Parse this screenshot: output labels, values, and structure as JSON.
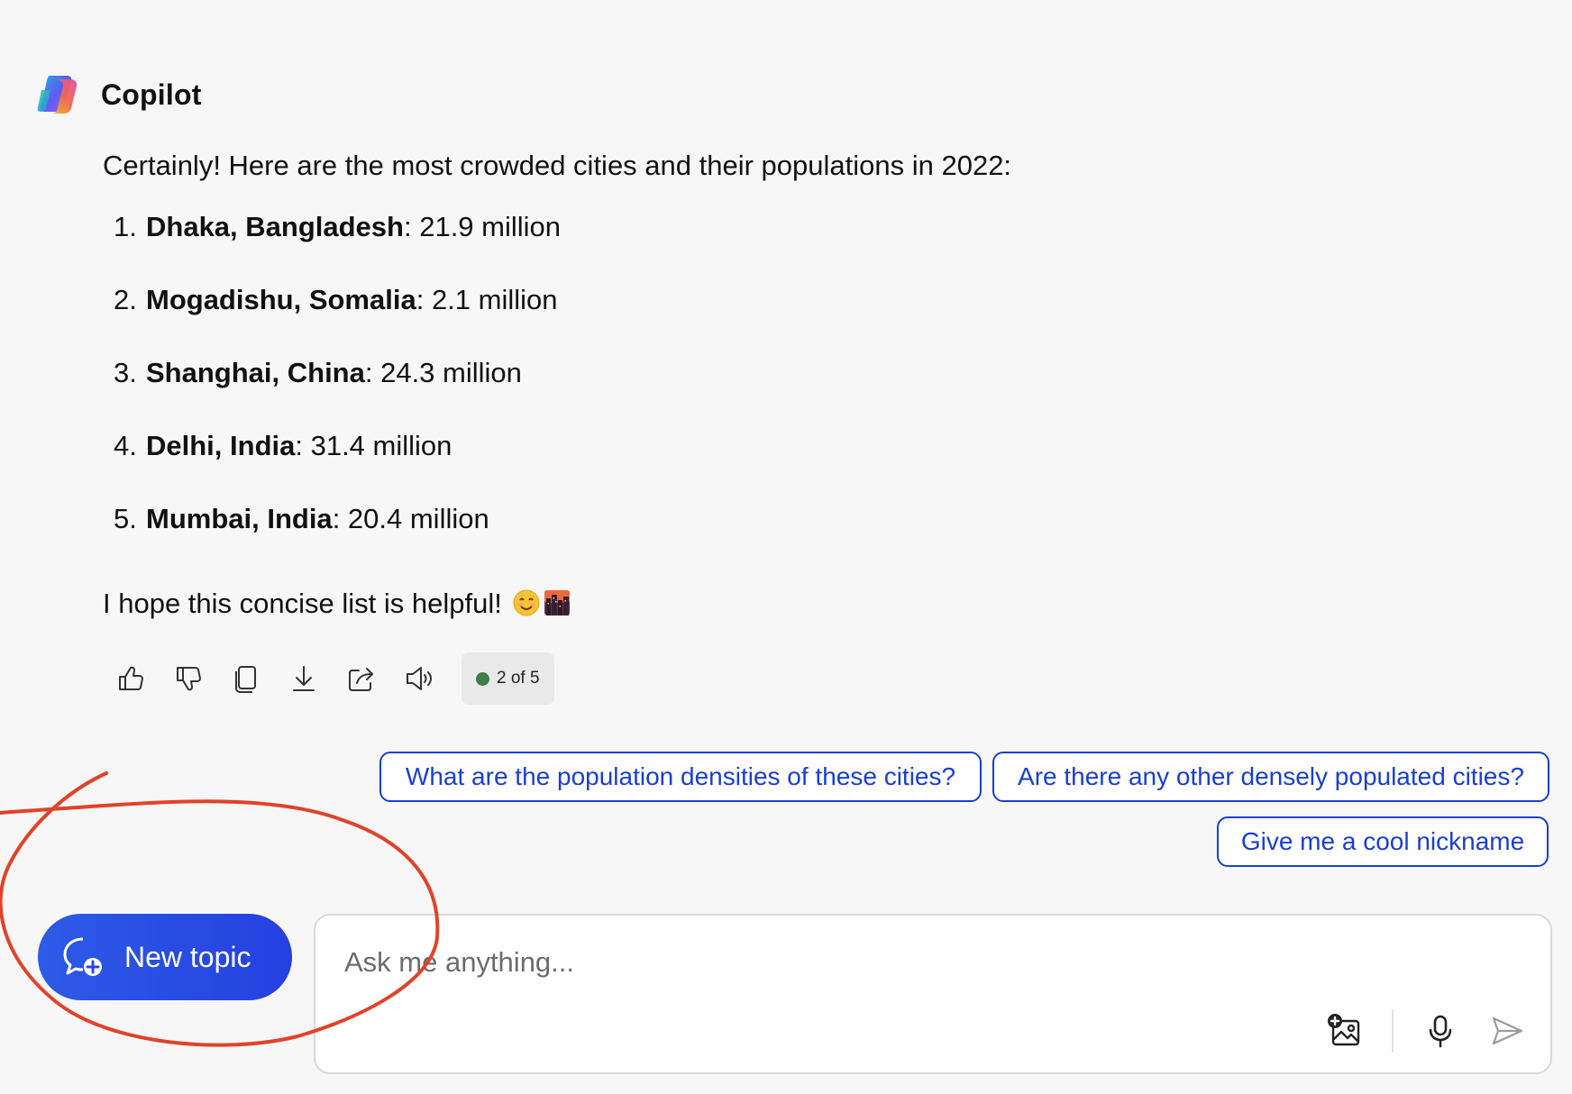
{
  "app": {
    "title": "Copilot"
  },
  "message": {
    "intro": "Certainly! Here are the most crowded cities and their populations in 2022:",
    "items": [
      {
        "num": "1.",
        "name": "Dhaka, Bangladesh",
        "value": ": 21.9 million"
      },
      {
        "num": "2.",
        "name": "Mogadishu, Somalia",
        "value": ": 2.1 million"
      },
      {
        "num": "3.",
        "name": "Shanghai, China",
        "value": ": 24.3 million"
      },
      {
        "num": "4.",
        "name": "Delhi, India",
        "value": ": 31.4 million"
      },
      {
        "num": "5.",
        "name": "Mumbai, India",
        "value": ": 20.4 million"
      }
    ],
    "closing": "I hope this concise list is helpful!",
    "emojis": [
      "smiling-face-emoji",
      "cityscape-emoji"
    ]
  },
  "toolbar": {
    "icons": [
      "thumbs-up-icon",
      "thumbs-down-icon",
      "copy-icon",
      "download-icon",
      "share-icon",
      "read-aloud-icon"
    ],
    "counter": "2 of 5",
    "counter_dot_color": "#3f7d4a"
  },
  "suggestions": [
    "What are the population densities of these cities?",
    "Are there any other densely populated cities?",
    "Give me a cool nickname"
  ],
  "new_topic": {
    "label": "New topic",
    "color": "#2845e2"
  },
  "input": {
    "placeholder": "Ask me anything...",
    "tools": [
      "add-image-icon",
      "microphone-icon",
      "send-icon"
    ]
  },
  "annotation": {
    "color": "#e0432b",
    "shape": "hand-drawn circle around New topic button"
  }
}
